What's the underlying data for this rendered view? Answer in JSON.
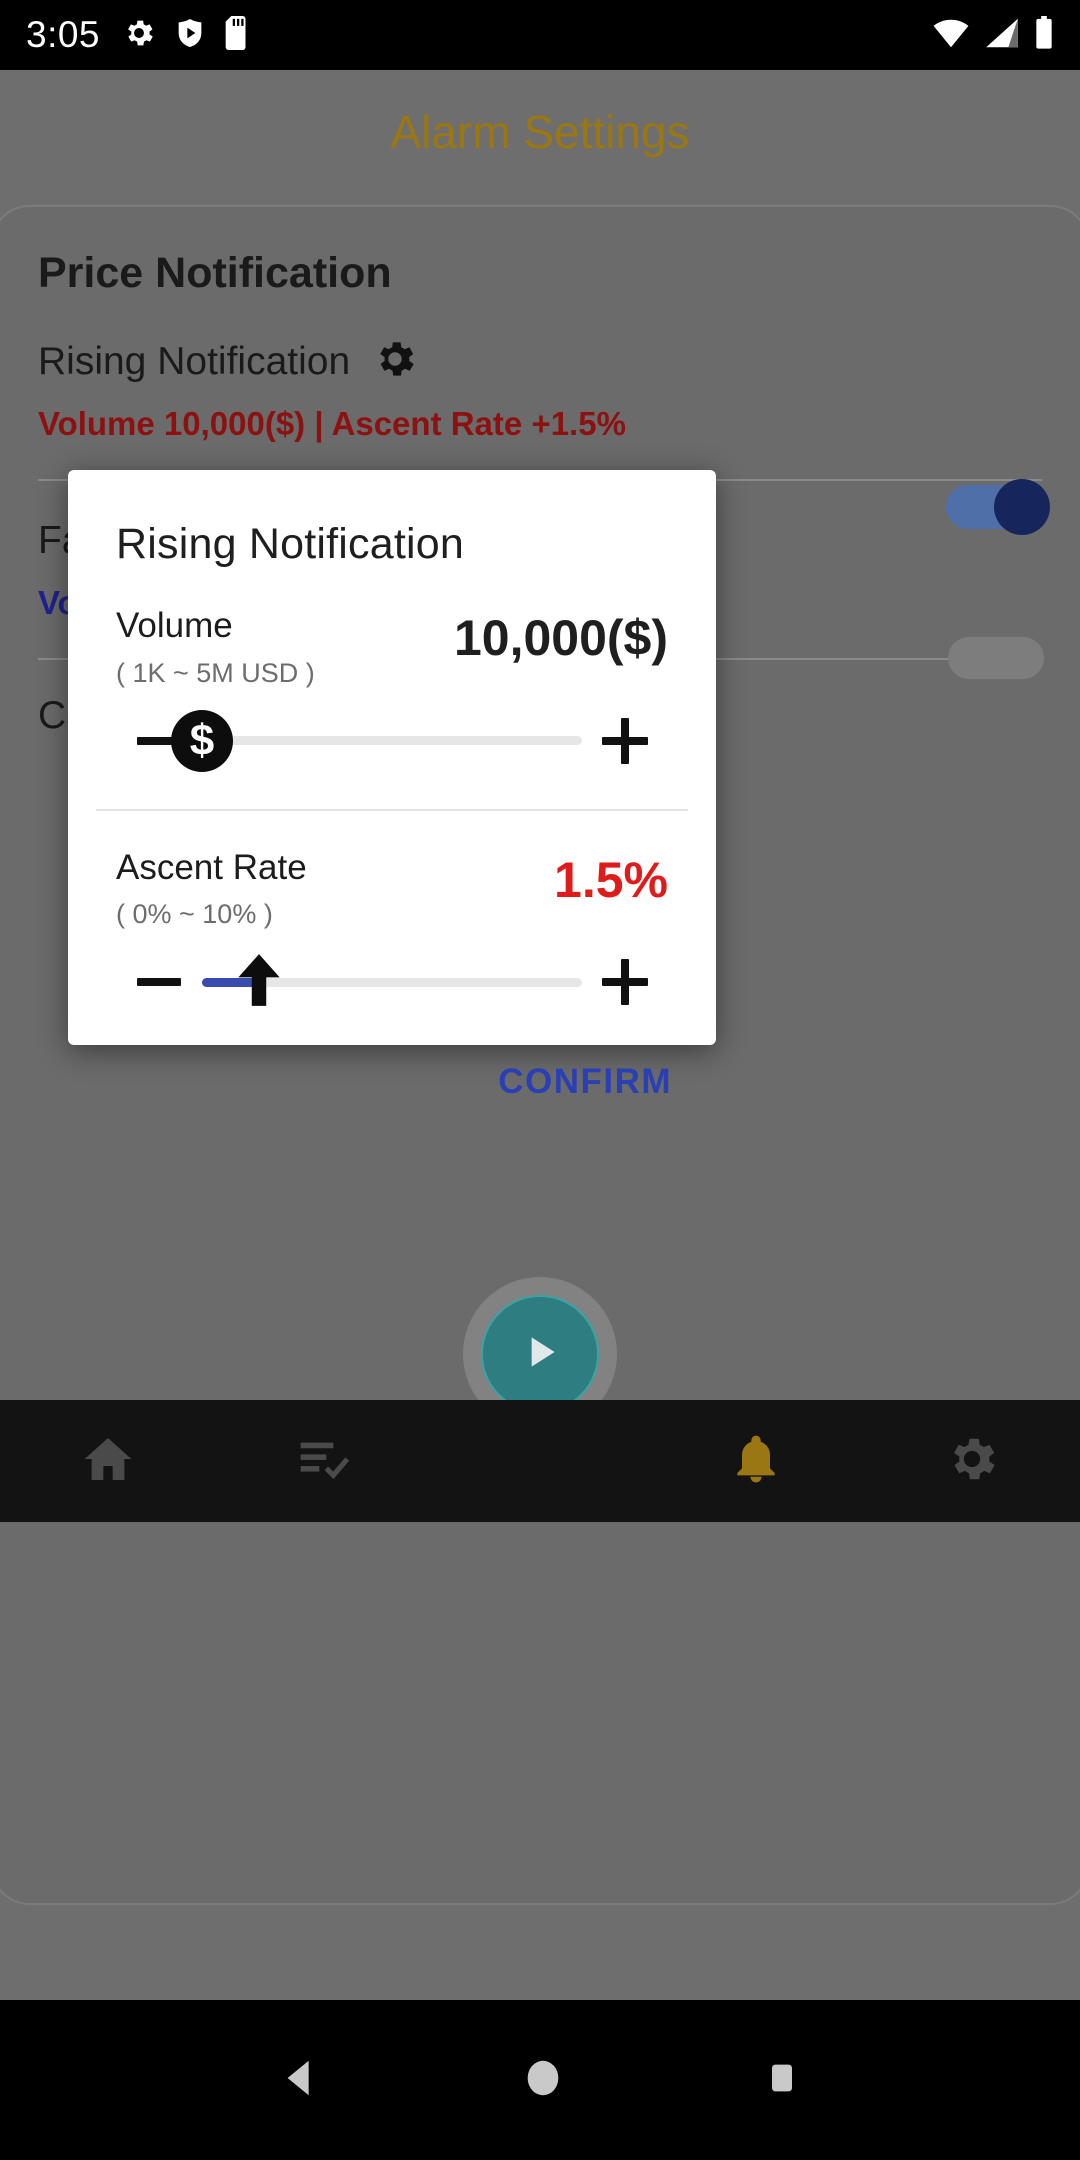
{
  "status_bar": {
    "time": "3:05",
    "left_icons": [
      "gear-icon",
      "shield-play-icon",
      "sd-card-icon"
    ],
    "right_icons": [
      "wifi-icon",
      "cell-signal-icon",
      "battery-icon"
    ]
  },
  "background": {
    "app_title": "Alarm Settings",
    "card_title": "Price Notification",
    "rows": [
      {
        "label": "Rising Notification",
        "icon": "gear-icon",
        "summary": "Volume 10,000($) | Ascent Rate +1.5%",
        "summary_color": "#8c1111",
        "toggle_on": true
      },
      {
        "label": "Falling Notification",
        "icon": "gear-icon",
        "summary": "Vol",
        "summary_color": "#20218e",
        "toggle_on": false
      },
      {
        "label": "Ca",
        "icon": "",
        "summary": "",
        "summary_color": "#20218e",
        "toggle_on": false
      }
    ]
  },
  "dialog": {
    "title": "Rising Notification",
    "sections": [
      {
        "name": "Volume",
        "range": "( 1K ~ 5M USD )",
        "value": "10,000($)",
        "value_color": "#1f1f1f",
        "thumb_icon": "dollar-coin-icon",
        "thumb_glyph": "$",
        "fill_percent": 0,
        "thumb_percent": 0
      },
      {
        "name": "Ascent Rate",
        "range": "( 0% ~ 10% )",
        "value": "1.5%",
        "value_color": "#e01b1b",
        "thumb_icon": "up-arrow-icon",
        "thumb_glyph": "",
        "fill_percent": 15,
        "thumb_percent": 15
      }
    ],
    "minus_label": "decrease",
    "plus_label": "increase",
    "confirm_label": "CONFIRM",
    "confirm_color": "#2b3fb5"
  },
  "fab": {
    "icon": "play-icon",
    "color": "#2e7d80"
  },
  "bottom_nav": {
    "items": [
      {
        "icon": "home-icon",
        "active": false
      },
      {
        "icon": "checklist-icon",
        "active": false
      },
      {
        "icon": "bell-icon",
        "active": true
      },
      {
        "icon": "gear-icon",
        "active": false
      }
    ],
    "active_color": "#b08c10"
  },
  "system_nav": {
    "items": [
      "back-icon",
      "home-circle-icon",
      "recents-square-icon"
    ]
  }
}
